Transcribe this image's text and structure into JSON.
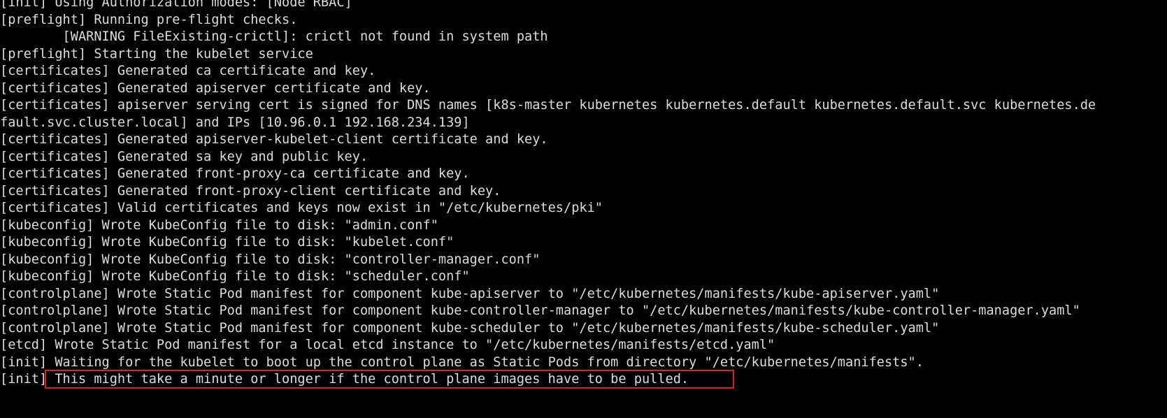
{
  "terminal": {
    "lines": [
      "[init] Using Authorization modes: [Node RBAC]",
      "[preflight] Running pre-flight checks.",
      "        [WARNING FileExisting-crictl]: crictl not found in system path",
      "[preflight] Starting the kubelet service",
      "[certificates] Generated ca certificate and key.",
      "[certificates] Generated apiserver certificate and key.",
      "[certificates] apiserver serving cert is signed for DNS names [k8s-master kubernetes kubernetes.default kubernetes.default.svc kubernetes.de",
      "fault.svc.cluster.local] and IPs [10.96.0.1 192.168.234.139]",
      "[certificates] Generated apiserver-kubelet-client certificate and key.",
      "[certificates] Generated sa key and public key.",
      "[certificates] Generated front-proxy-ca certificate and key.",
      "[certificates] Generated front-proxy-client certificate and key.",
      "[certificates] Valid certificates and keys now exist in \"/etc/kubernetes/pki\"",
      "[kubeconfig] Wrote KubeConfig file to disk: \"admin.conf\"",
      "[kubeconfig] Wrote KubeConfig file to disk: \"kubelet.conf\"",
      "[kubeconfig] Wrote KubeConfig file to disk: \"controller-manager.conf\"",
      "[kubeconfig] Wrote KubeConfig file to disk: \"scheduler.conf\"",
      "[controlplane] Wrote Static Pod manifest for component kube-apiserver to \"/etc/kubernetes/manifests/kube-apiserver.yaml\"",
      "[controlplane] Wrote Static Pod manifest for component kube-controller-manager to \"/etc/kubernetes/manifests/kube-controller-manager.yaml\"",
      "[controlplane] Wrote Static Pod manifest for component kube-scheduler to \"/etc/kubernetes/manifests/kube-scheduler.yaml\"",
      "[etcd] Wrote Static Pod manifest for a local etcd instance to \"/etc/kubernetes/manifests/etcd.yaml\"",
      "[init] Waiting for the kubelet to boot up the control plane as Static Pods from directory \"/etc/kubernetes/manifests\".",
      "[init] This might take a minute or longer if the control plane images have to be pulled."
    ],
    "colors": {
      "background": "#000000",
      "text": "#dcdcdc",
      "highlight_border": "#e0201e"
    }
  }
}
